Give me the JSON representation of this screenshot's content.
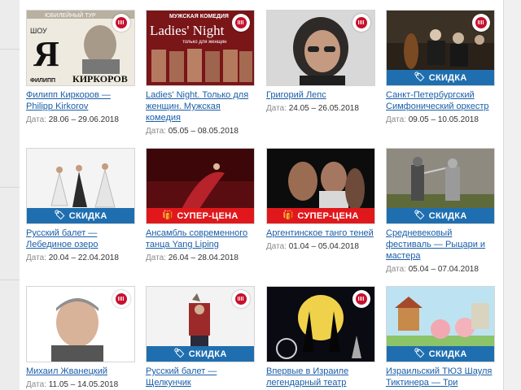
{
  "events": [
    {
      "title": "Филипп Киркоров — Philipp Kirkorov",
      "date_label": "Дата:",
      "date_value": "28.06 – 29.06.2018",
      "badge": "",
      "image_text": [
        "ЮБИЛЕЙНЫЙ ТУР",
        "ШОУ",
        "Я",
        "ФИЛИПП",
        "КИРКОРОВ"
      ]
    },
    {
      "title": "Ladies' Night. Только для женщин. Мужская комедия",
      "date_label": "Дата:",
      "date_value": "05.05 – 08.05.2018",
      "badge": "",
      "image_text": [
        "МУЖСКАЯ КОМЕДИЯ",
        "Ladies' Night",
        "только для женщин"
      ]
    },
    {
      "title": "Григорий Лепс",
      "date_label": "Дата:",
      "date_value": "24.05 – 26.05.2018",
      "badge": "",
      "image_text": []
    },
    {
      "title": "Санкт-Петербургский Симфонический оркестр",
      "date_label": "Дата:",
      "date_value": "09.05 – 10.05.2018",
      "badge": "СКИДКА",
      "image_text": []
    },
    {
      "title": "Русский балет — Лебединое озеро",
      "date_label": "Дата:",
      "date_value": "20.04 – 22.04.2018",
      "badge": "СКИДКА",
      "image_text": []
    },
    {
      "title": "Ансамбль современного танца Yang Liping",
      "date_label": "Дата:",
      "date_value": "26.04 – 28.04.2018",
      "badge": "СУПЕР-ЦЕНА",
      "image_text": []
    },
    {
      "title": "Аргентинское танго теней",
      "date_label": "Дата:",
      "date_value": "01.04 – 05.04.2018",
      "badge": "СУПЕР-ЦЕНА",
      "image_text": []
    },
    {
      "title": "Средневековый фестиваль — Рыцари и мастера",
      "date_label": "Дата:",
      "date_value": "05.04 – 07.04.2018",
      "badge": "СКИДКА",
      "image_text": []
    },
    {
      "title": "Михаил Жванецкий",
      "date_label": "Дата:",
      "date_value": "11.05 – 14.05.2018",
      "badge": "",
      "image_text": []
    },
    {
      "title": "Русский балет — Щелкунчик",
      "date_label": "",
      "date_value": "",
      "badge": "СКИДКА",
      "image_text": []
    },
    {
      "title": "Впервые в Израиле легендарный театр",
      "date_label": "",
      "date_value": "",
      "badge": "",
      "image_text": []
    },
    {
      "title": "Израильский ТЮЗ Шауля Тиктинера — Три",
      "date_label": "",
      "date_value": "",
      "badge": "СКИДКА",
      "image_text": []
    }
  ],
  "colors": {
    "badge_discount": "#1f6fb0",
    "badge_super_price": "#e0181c",
    "link": "#1a5ea8",
    "ticket_icon": "#c8102e"
  }
}
